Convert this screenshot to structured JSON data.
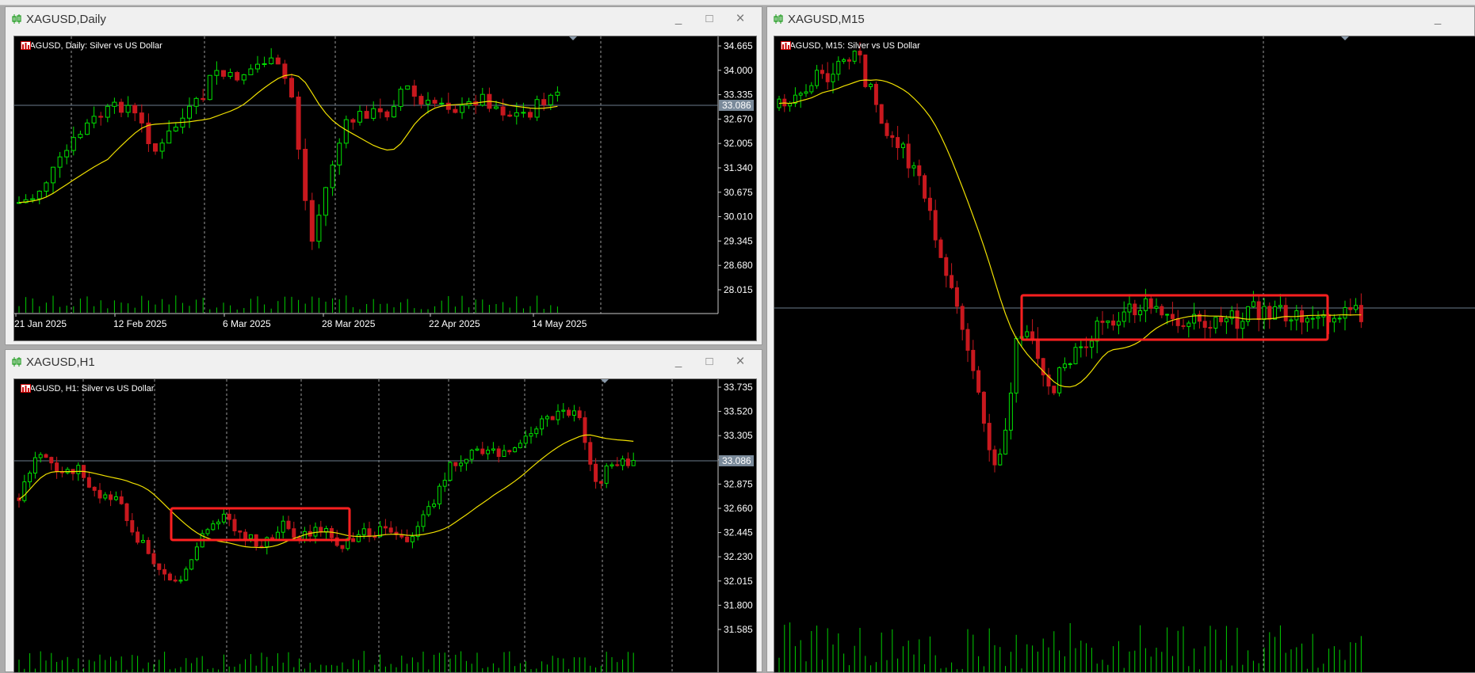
{
  "colors": {
    "bull": "#00e000",
    "bear": "#c8181e",
    "ma": "#f0e000",
    "grid": "#9a9a9a",
    "volume": "#00d000",
    "highlight": "#ff2020",
    "current_line": "#6c7b8b",
    "current_tag_bg": "#7a8a9a"
  },
  "windows": [
    {
      "id": "daily",
      "title": "XAGUSD,Daily",
      "legend": "XAGUSD, Daily:  Silver vs US Dollar",
      "price_labels": [
        "34.665",
        "34.000",
        "33.335",
        "32.670",
        "32.005",
        "31.340",
        "30.675",
        "30.010",
        "29.345",
        "28.680",
        "28.015"
      ],
      "current_price": "33.086",
      "date_labels": [
        "21 Jan 2025",
        "12 Feb 2025",
        "6 Mar 2025",
        "28 Mar 2025",
        "22 Apr 2025",
        "14 May 2025"
      ]
    },
    {
      "id": "h1",
      "title": "XAGUSD,H1",
      "legend": "XAGUSD, H1:  Silver vs US Dollar",
      "price_labels": [
        "33.735",
        "33.520",
        "33.305",
        "33.086",
        "32.875",
        "32.660",
        "32.445",
        "32.230",
        "32.015",
        "31.800",
        "31.585"
      ],
      "current_price": "33.086",
      "date_labels": []
    },
    {
      "id": "m15",
      "title": "XAGUSD,M15",
      "legend": "XAGUSD, M15:  Silver vs US Dollar",
      "price_labels": [],
      "current_price": "",
      "date_labels": []
    }
  ],
  "icons": {
    "window_icon": "candlestick-icon",
    "legend_icon_1": "chart-grid-icon",
    "legend_icon_2": "chart-bars-icon"
  },
  "window_buttons": {
    "minimize": "_",
    "maximize": "□",
    "close": "×"
  }
}
